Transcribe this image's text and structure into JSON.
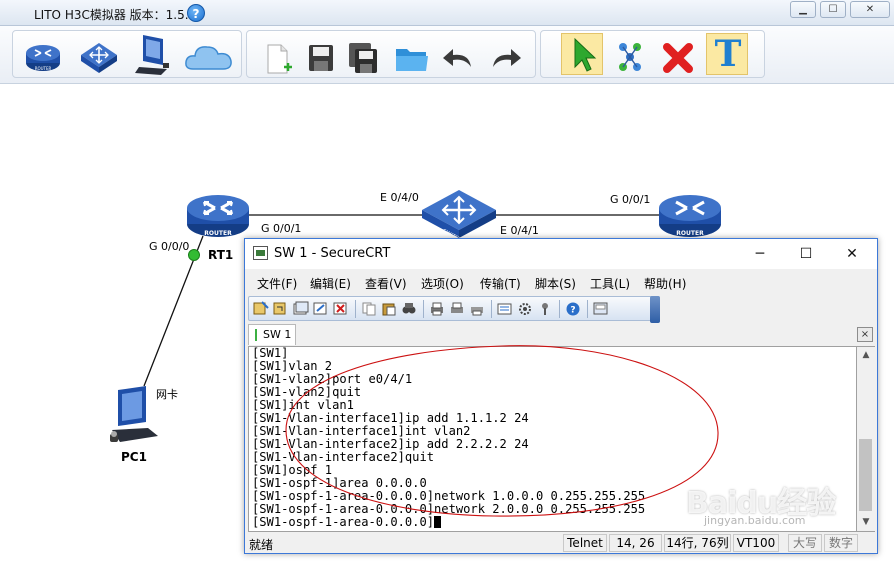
{
  "app": {
    "title": "LITO H3C模拟器 版本：1.5.2",
    "help_icon": "?",
    "window_controls": [
      "minimize",
      "maximize",
      "close"
    ]
  },
  "toolbar": {
    "device_tools": [
      "router-icon",
      "switch-icon",
      "pc-icon",
      "cloud-icon"
    ],
    "file_tools": [
      "new-file-icon",
      "save-icon",
      "save-as-icon",
      "open-folder-icon",
      "undo-icon",
      "redo-icon"
    ],
    "edit_tools": [
      "select-pointer-icon",
      "connect-icon",
      "delete-icon",
      "text-tool-icon"
    ],
    "text_tool_glyph": "T"
  },
  "topology": {
    "devices": [
      {
        "name": "RT1",
        "type": "router",
        "badge": "ROUTER"
      },
      {
        "name": "",
        "type": "switch",
        "badge": "SWITCH"
      },
      {
        "name": "",
        "type": "router",
        "badge": "ROUTER"
      },
      {
        "name": "PC1",
        "type": "pc",
        "badge": ""
      }
    ],
    "ports": {
      "rt1_g000": "G 0/0/0",
      "rt1_g001": "G 0/0/1",
      "sw_e040": "E 0/4/0",
      "sw_e041": "E 0/4/1",
      "rt2_g001": "G 0/0/1",
      "pc_nic": "网卡"
    }
  },
  "securecrt": {
    "title": "SW 1 - SecureCRT",
    "menu": [
      "文件(F)",
      "编辑(E)",
      "查看(V)",
      "选项(O)",
      "传输(T)",
      "脚本(S)",
      "工具(L)",
      "帮助(H)"
    ],
    "tab_label": "SW 1",
    "tab_close": "×",
    "terminal_lines": [
      "[SW1]",
      "[SW1]vlan 2",
      "[SW1-vlan2]port e0/4/1",
      "[SW1-vlan2]quit",
      "[SW1]int vlan1",
      "[SW1-Vlan-interface1]ip add 1.1.1.2 24",
      "[SW1-Vlan-interface1]int vlan2",
      "[SW1-Vlan-interface2]ip add 2.2.2.2 24",
      "[SW1-Vlan-interface2]quit",
      "[SW1]ospf 1",
      "[SW1-ospf-1]area 0.0.0.0",
      "[SW1-ospf-1-area-0.0.0.0]network 1.0.0.0 0.255.255.255",
      "[SW1-ospf-1-area-0.0.0.0]network 2.0.0.0 0.255.255.255",
      "[SW1-ospf-1-area-0.0.0.0]"
    ],
    "status": {
      "ready": "就绪",
      "protocol": "Telnet",
      "cursor_pos": "14,  26",
      "rows_cols": "14行, 76列",
      "terminal_type": "VT100",
      "caps": "大写",
      "num": "数字"
    }
  },
  "watermark": {
    "text": "Baidu经验",
    "sub": "jingyan.baidu.com"
  },
  "colors": {
    "annotation": "#cc1111",
    "device_blue": "#1f4fa8",
    "link_dot": "#33bb33"
  }
}
